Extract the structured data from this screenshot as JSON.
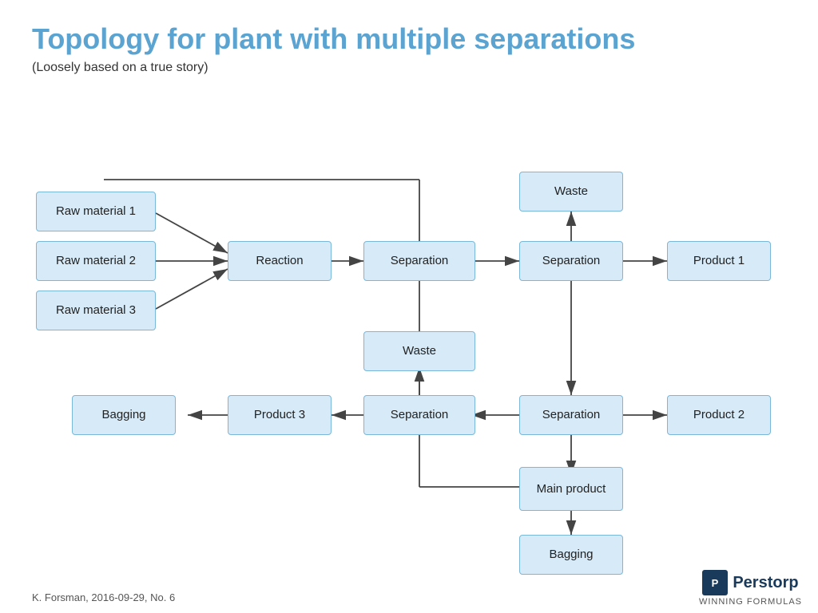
{
  "title": "Topology for plant with multiple separations",
  "subtitle": "(Loosely based on a true story)",
  "footer": "K. Forsman, 2016-09-29, No. 6",
  "logo": {
    "name": "Perstorp",
    "tagline": "WINNING FORMULAS"
  },
  "boxes": {
    "raw1": "Raw material 1",
    "raw2": "Raw material 2",
    "raw3": "Raw material 3",
    "reaction": "Reaction",
    "sep1": "Separation",
    "sep2": "Separation",
    "sep3": "Separation",
    "sep4": "Separation",
    "waste1": "Waste",
    "waste2": "Waste",
    "product1": "Product 1",
    "product2": "Product 2",
    "product3": "Product 3",
    "mainproduct": "Main\nproduct",
    "bagging1": "Bagging",
    "bagging2": "Bagging"
  }
}
